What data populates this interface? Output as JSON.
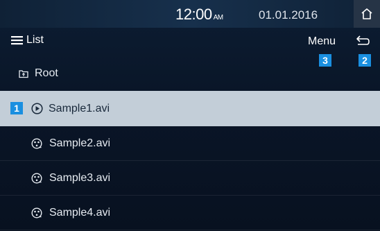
{
  "status": {
    "time": "12:00",
    "ampm": "AM",
    "date": "01.01.2016"
  },
  "toolbar": {
    "list_label": "List",
    "menu_label": "Menu"
  },
  "badges": {
    "first": "1",
    "second": "2",
    "third": "3"
  },
  "rows": [
    {
      "label": "Root",
      "icon": "folder-up-icon"
    },
    {
      "label": "Sample1.avi",
      "icon": "play-circle-icon",
      "selected": true
    },
    {
      "label": "Sample2.avi",
      "icon": "film-reel-icon"
    },
    {
      "label": "Sample3.avi",
      "icon": "film-reel-icon"
    },
    {
      "label": "Sample4.avi",
      "icon": "film-reel-icon"
    }
  ],
  "colors": {
    "accent": "#1a8fe0",
    "selected_row": "#c3ced8",
    "background": "#0a1628"
  }
}
